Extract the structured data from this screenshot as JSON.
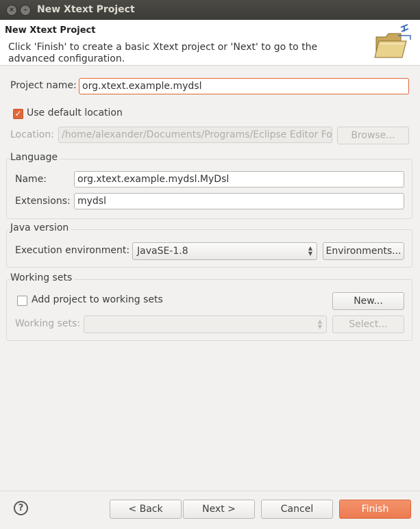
{
  "window": {
    "title": "New Xtext Project"
  },
  "header": {
    "title": "New Xtext Project",
    "message": "Click 'Finish' to create a basic Xtext project or 'Next' to go to the advanced configuration.",
    "icon": "folder-wizard-icon"
  },
  "project": {
    "name_label": "Project name:",
    "name_value": "org.xtext.example.mydsl",
    "use_default_label": "Use default location",
    "use_default_checked": true,
    "location_label": "Location:",
    "location_value": "/home/alexander/Documents/Programs/Eclipse Editor Fo",
    "browse_label": "Browse..."
  },
  "language": {
    "group_title": "Language",
    "name_label": "Name:",
    "name_value": "org.xtext.example.mydsl.MyDsl",
    "extensions_label": "Extensions:",
    "extensions_value": "mydsl"
  },
  "java": {
    "group_title": "Java version",
    "env_label": "Execution environment:",
    "env_value": "JavaSE-1.8",
    "environments_label": "Environments..."
  },
  "working_sets": {
    "group_title": "Working sets",
    "add_label": "Add project to working sets",
    "add_checked": false,
    "new_label": "New...",
    "sets_label": "Working sets:",
    "sets_value": "",
    "select_label": "Select..."
  },
  "footer": {
    "help": "?",
    "back_label": "< Back",
    "next_label": "Next >",
    "cancel_label": "Cancel",
    "finish_label": "Finish"
  },
  "colors": {
    "accent": "#e2663a",
    "titlebar": "#3d3c38"
  }
}
